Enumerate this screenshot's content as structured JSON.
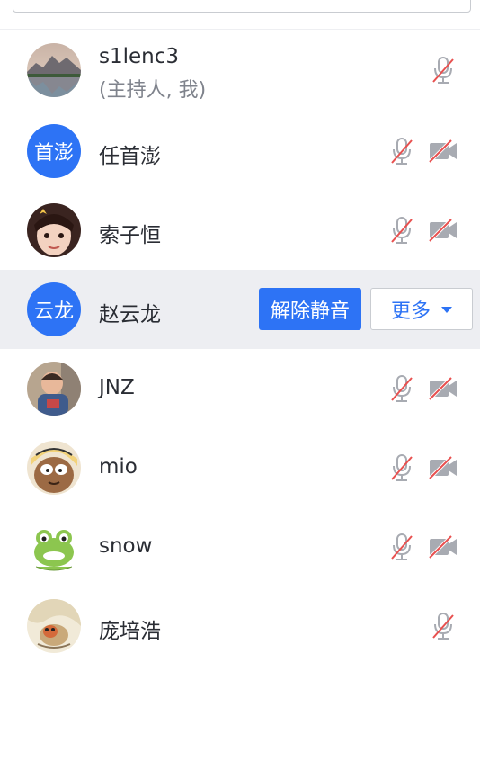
{
  "participants": [
    {
      "name": "s1lenc3",
      "sub": "(主持人, 我)"
    },
    {
      "name": "任首澎",
      "avatar_text": "首澎"
    },
    {
      "name": "索子恒"
    },
    {
      "name": "赵云龙",
      "avatar_text": "云龙"
    },
    {
      "name": "JNZ"
    },
    {
      "name": "mio"
    },
    {
      "name": "snow"
    },
    {
      "name": "庞培浩"
    }
  ],
  "actions": {
    "unmute_label": "解除静音",
    "more_label": "更多"
  },
  "colors": {
    "accent": "#2d73f5",
    "muted_slash": "#e8504f",
    "icon_gray": "#a8abb2",
    "hover_row": "#edeef2"
  },
  "icons": {
    "mic": "mic-muted-icon",
    "camera": "camera-off-icon",
    "caret": "caret-down-icon"
  }
}
